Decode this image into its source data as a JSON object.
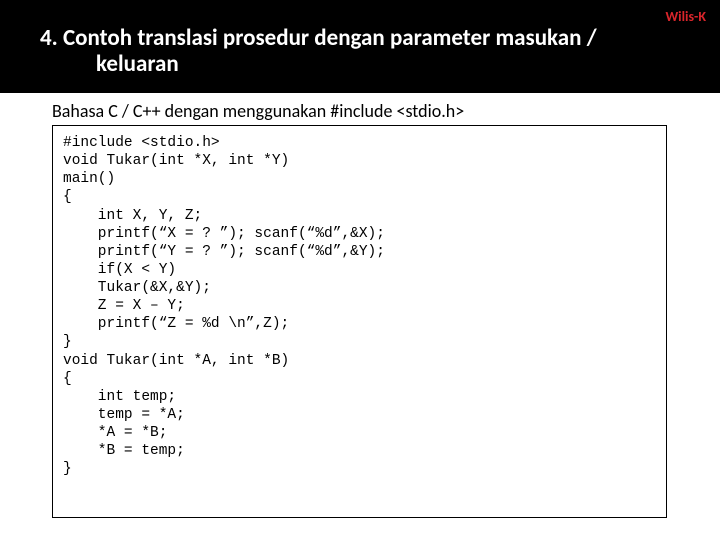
{
  "author": "Wilis-K",
  "heading_line1": "4. Contoh translasi prosedur dengan parameter masukan /",
  "heading_line2": "keluaran",
  "subtitle": "Bahasa C / C++ dengan menggunakan #include <stdio.h>",
  "code": "#include <stdio.h>\nvoid Tukar(int *X, int *Y)\nmain()\n{\n    int X, Y, Z;\n    printf(“X = ? ”); scanf(“%d”,&X);\n    printf(“Y = ? ”); scanf(“%d”,&Y);\n    if(X < Y)\n    Tukar(&X,&Y);\n    Z = X – Y;\n    printf(“Z = %d \\n”,Z);\n}\nvoid Tukar(int *A, int *B)\n{\n    int temp;\n    temp = *A;\n    *A = *B;\n    *B = temp;\n}"
}
